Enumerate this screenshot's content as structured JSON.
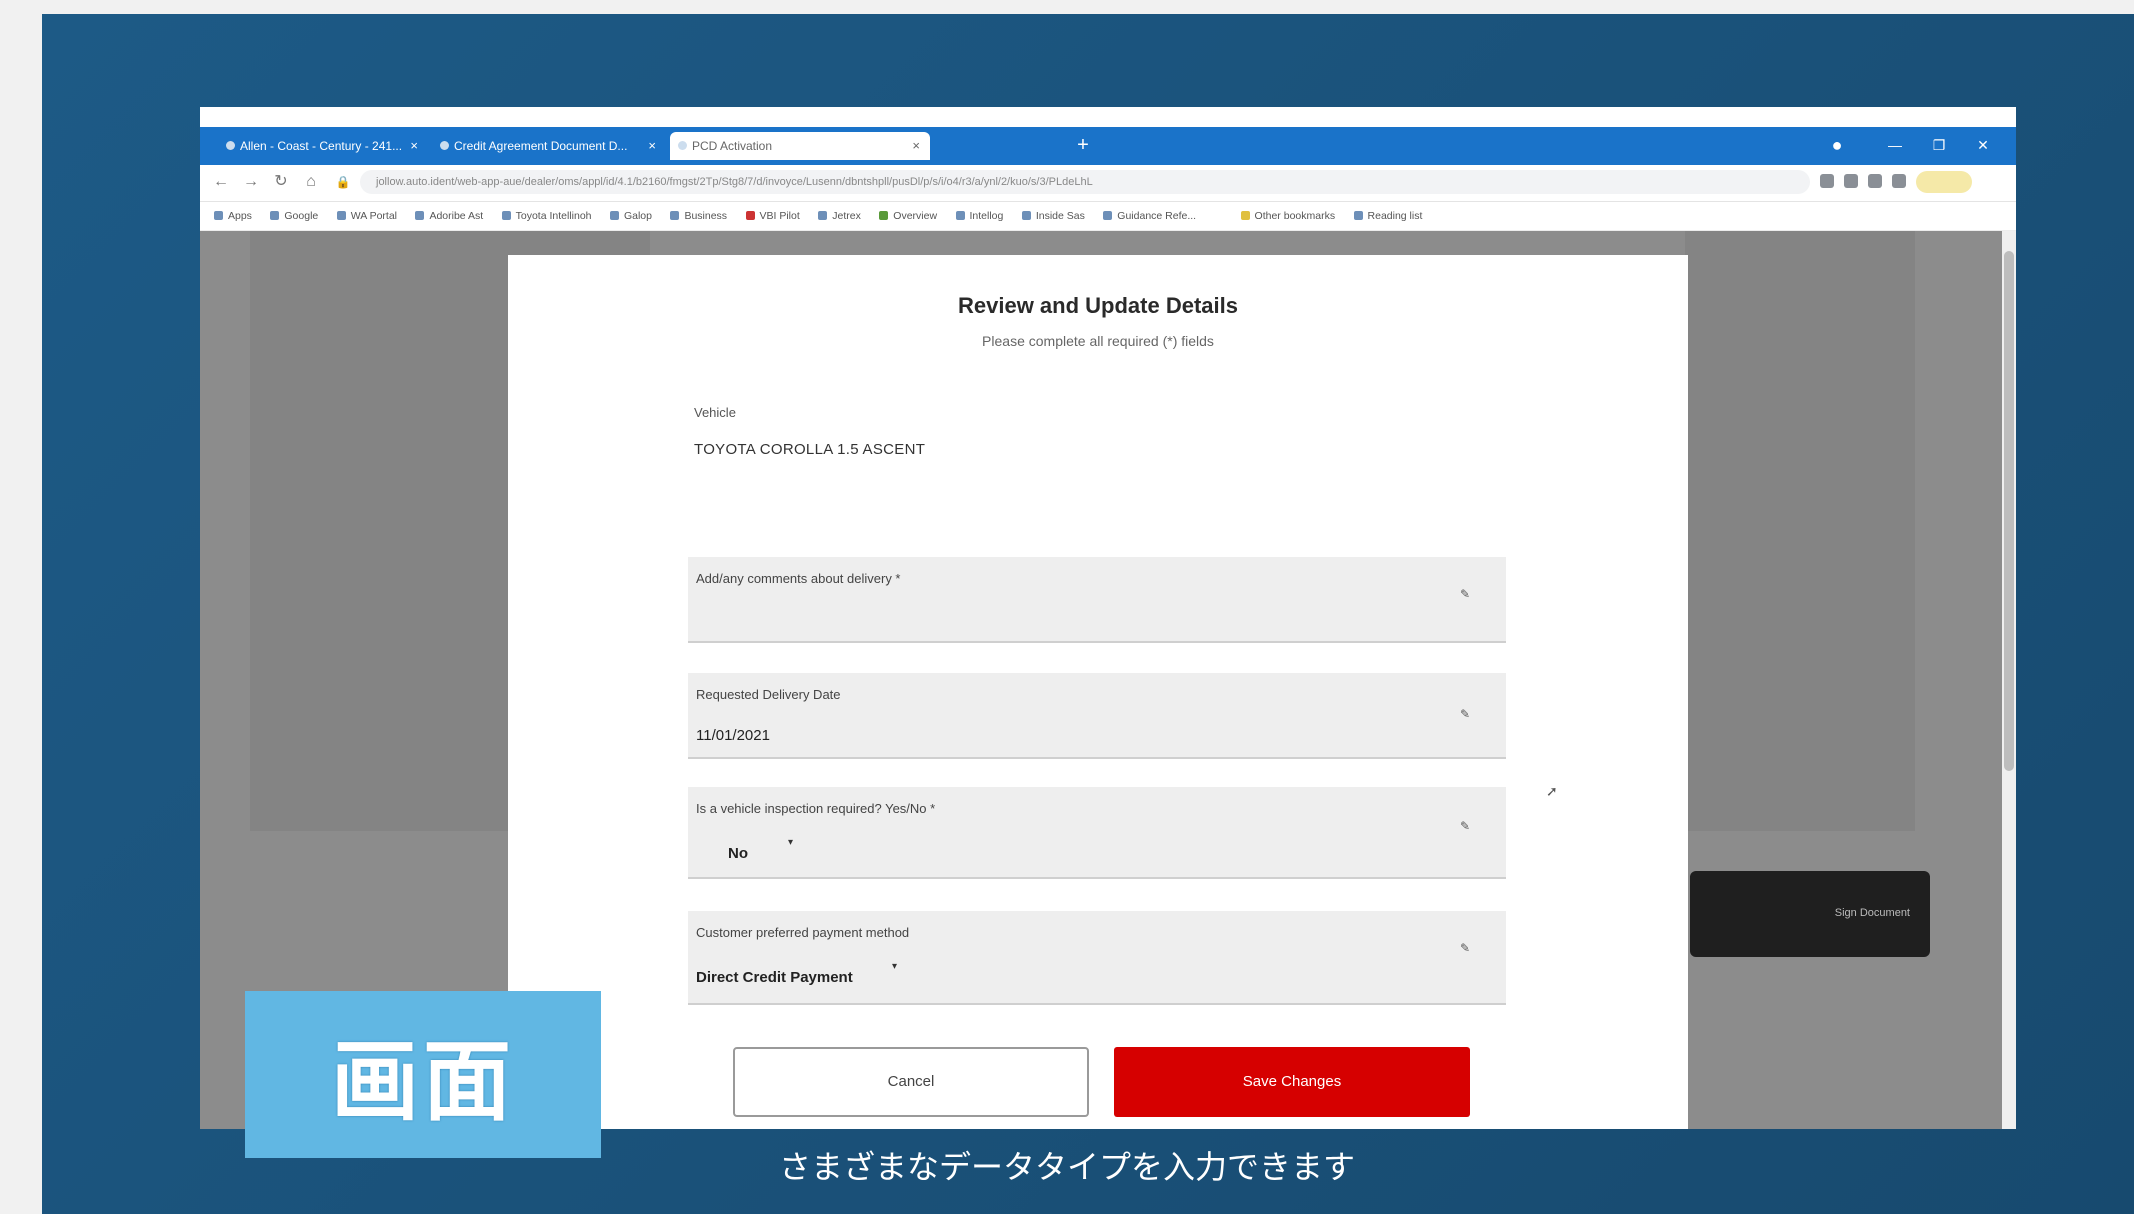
{
  "browser": {
    "tabs": [
      {
        "label": "Allen - Coast - Century - 241..."
      },
      {
        "label": "Credit Agreement Document D..."
      },
      {
        "label": "PCD Activation"
      }
    ],
    "new_tab_label": "+",
    "window_controls": {
      "minimize": "—",
      "maximize": "❐",
      "close": "✕"
    },
    "address": "jollow.auto.ident/web-app-aue/dealer/oms/appl/id/4.1/b2160/fmgst/2Tp/Stg8/7/d/invoyce/Lusenn/dbntshpll/pusDl/p/s/i/o4/r3/a/ynl/2/kuo/s/3/PLdeLhL"
  },
  "bookmarks": [
    "Apps",
    "Google",
    "WA Portal",
    "Adoribe Ast",
    "Toyota Intellinoh",
    "Galop",
    "Business",
    "VBI Pilot",
    "Jetrex",
    "Overview",
    "Intellog",
    "Inside Sas",
    "Guidance Refe...",
    "Other bookmarks",
    "Reading list"
  ],
  "modal": {
    "title": "Review and Update Details",
    "subtitle": "Please complete all required (*) fields",
    "vehicle": {
      "label": "Vehicle",
      "value": "TOYOTA COROLLA 1.5 ASCENT"
    },
    "fields": [
      {
        "label": "Add/any comments about delivery *",
        "value": ""
      },
      {
        "label": "Requested Delivery Date",
        "value": "11/01/2021"
      },
      {
        "label": "Is a vehicle inspection required? Yes/No *",
        "value": "No"
      },
      {
        "label": "Customer preferred payment method",
        "value": "Direct Credit Payment"
      }
    ],
    "cancel_label": "Cancel",
    "save_label": "Save Changes"
  },
  "toast": {
    "text": "Sign Document"
  },
  "overlay": {
    "badge": "画面",
    "caption": "さまざまなデータタイプを入力できます"
  }
}
